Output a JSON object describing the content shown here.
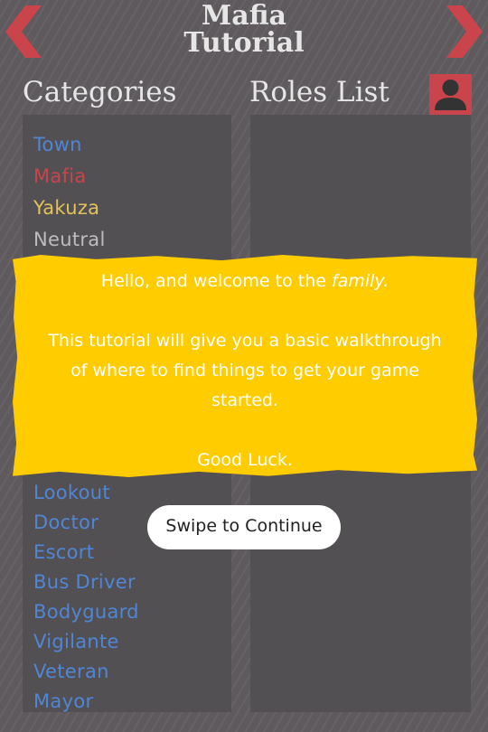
{
  "header": {
    "title_line1": "Mafia",
    "title_line2": "Tutorial"
  },
  "icons": {
    "back": "chevron-left-icon",
    "forward": "chevron-right-icon",
    "profile": "user-icon"
  },
  "colors": {
    "town": "#4f86d6",
    "mafia": "#c9444b",
    "yakuza": "#ffcc00",
    "neutral": "#bdbdbd",
    "overlay": "#ffcc00",
    "nav_arrows": "#c9444b"
  },
  "categories": {
    "heading": "Categories",
    "items": [
      {
        "label": "Town",
        "color": "#4f86d6"
      },
      {
        "label": "Mafia",
        "color": "#c9444b"
      },
      {
        "label": "Yakuza",
        "color": "#e3c25a"
      },
      {
        "label": "Neutral",
        "color": "#bdbdbd"
      }
    ],
    "roles": [
      "Lookout",
      "Doctor",
      "Escort",
      "Bus Driver",
      "Bodyguard",
      "Vigilante",
      "Veteran",
      "Mayor"
    ]
  },
  "roles_panel": {
    "heading": "Roles List"
  },
  "overlay": {
    "line_welcome_prefix": "Hello, and welcome to the ",
    "line_welcome_emph": "family.",
    "line_body": "This tutorial will give you a basic walkthrough of where to find things to get your game started.",
    "line_luck": "Good Luck."
  },
  "swipe_button": {
    "label": "Swipe to Continue"
  }
}
